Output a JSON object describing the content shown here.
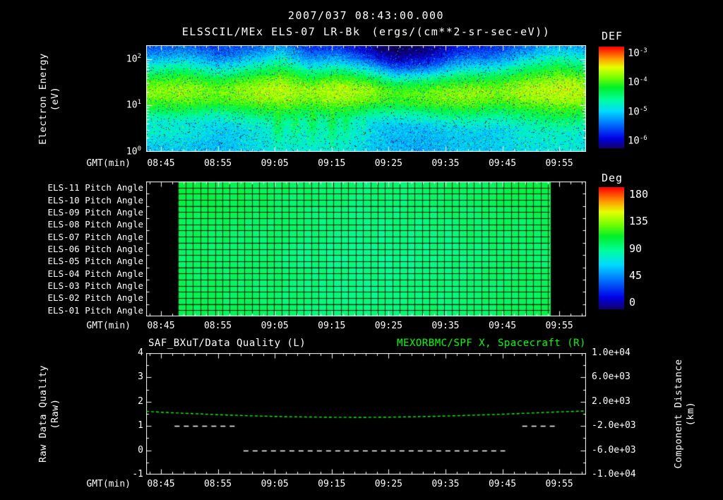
{
  "app": {
    "background": "#000000",
    "foreground": "#ffffff",
    "accent_green": "#00ff00"
  },
  "chart_data": [
    {
      "id": "electron_energy_spectrogram",
      "type": "heatmap",
      "timestamp": "2007/037 08:43:00.000",
      "title": "ELSSCIL/MEx ELS-07 LR-Bk",
      "units": "(ergs/(cm**2-sr-sec-eV))",
      "x": {
        "label": "GMT(min)",
        "tick_labels": [
          "08:45",
          "08:55",
          "09:05",
          "09:15",
          "09:25",
          "09:35",
          "09:45",
          "09:55"
        ],
        "tick_minutes": [
          0,
          10,
          20,
          30,
          40,
          50,
          60,
          70
        ],
        "start_min": -2.6,
        "end_min": 74.7,
        "minor_step_min": 2
      },
      "y": {
        "label_line1": "Electron Energy",
        "label_line2": "(eV)",
        "scale": "log",
        "range_ev": [
          1,
          200
        ],
        "tick_exponents": [
          "2",
          "1",
          "0"
        ]
      },
      "z": {
        "label": "DEF",
        "log10_range": [
          -6,
          -3
        ],
        "tick_exponents": [
          "-3",
          "-4",
          "-5",
          "-6"
        ]
      },
      "band_keyframes": [
        {
          "t": -2.6,
          "peak": -3.9,
          "center": 1.3,
          "width": 0.3,
          "low": -5.0,
          "high": -5.6,
          "down": 0.25,
          "l2": 0.8
        },
        {
          "t": 4,
          "peak": -3.85,
          "center": 1.32,
          "width": 0.32,
          "low": -5.0,
          "high": -5.6,
          "down": 0.3,
          "l2": 0.7
        },
        {
          "t": 10,
          "peak": -3.95,
          "center": 1.28,
          "width": 0.27,
          "low": -5.05,
          "high": -5.6,
          "down": 0.25,
          "l2": 0.3
        },
        {
          "t": 16,
          "peak": -3.8,
          "center": 1.3,
          "width": 0.3,
          "low": -4.95,
          "high": -5.55,
          "down": 0.4,
          "l2": 0
        },
        {
          "t": 21,
          "peak": -3.72,
          "center": 1.33,
          "width": 0.34,
          "low": -4.85,
          "high": -5.5,
          "down": 0.6,
          "l2": 0
        },
        {
          "t": 26,
          "peak": -3.85,
          "center": 1.28,
          "width": 0.3,
          "low": -4.9,
          "high": -5.75,
          "down": 0.7,
          "l2": 0
        },
        {
          "t": 31,
          "peak": -3.72,
          "center": 1.3,
          "width": 0.31,
          "low": -4.85,
          "high": -5.8,
          "down": 0.8,
          "l2": 0
        },
        {
          "t": 36,
          "peak": -3.82,
          "center": 1.3,
          "width": 0.28,
          "low": -5.0,
          "high": -6.0,
          "down": 0.5,
          "l2": 0
        },
        {
          "t": 41,
          "peak": -4.05,
          "center": 1.24,
          "width": 0.26,
          "low": -5.1,
          "high": -6.2,
          "down": 0.3,
          "l2": 0
        },
        {
          "t": 47,
          "peak": -3.95,
          "center": 1.22,
          "width": 0.27,
          "low": -5.1,
          "high": -6.05,
          "down": 0.25,
          "l2": 0
        },
        {
          "t": 53,
          "peak": -3.85,
          "center": 1.25,
          "width": 0.3,
          "low": -5.0,
          "high": -5.8,
          "down": 0.3,
          "l2": 0
        },
        {
          "t": 59,
          "peak": -3.9,
          "center": 1.28,
          "width": 0.29,
          "low": -5.0,
          "high": -5.7,
          "down": 0.35,
          "l2": 0
        },
        {
          "t": 64,
          "peak": -3.78,
          "center": 1.31,
          "width": 0.33,
          "low": -4.9,
          "high": -5.6,
          "down": 0.45,
          "l2": 0
        },
        {
          "t": 70,
          "peak": -3.7,
          "center": 1.33,
          "width": 0.37,
          "low": -4.85,
          "high": -5.5,
          "down": 0.5,
          "l2": 0
        },
        {
          "t": 74.7,
          "peak": -3.75,
          "center": 1.31,
          "width": 0.35,
          "low": -4.9,
          "high": -5.55,
          "down": 0.45,
          "l2": 0
        }
      ],
      "streaks": [
        {
          "t": 20.5,
          "w": 0.9,
          "amp": 0.95
        },
        {
          "t": 23.5,
          "w": 0.8,
          "amp": 0.85
        },
        {
          "t": 26.5,
          "w": 0.9,
          "amp": 1.0
        },
        {
          "t": 30,
          "w": 0.8,
          "amp": 0.95
        },
        {
          "t": 32.5,
          "w": 0.7,
          "amp": 0.8
        },
        {
          "t": 35.5,
          "w": 0.6,
          "amp": 0.65
        }
      ]
    },
    {
      "id": "pitch_angle_panels",
      "type": "heatmap",
      "rows": [
        "ELS-11 Pitch Angle",
        "ELS-10 Pitch Angle",
        "ELS-09 Pitch Angle",
        "ELS-08 Pitch Angle",
        "ELS-07 Pitch Angle",
        "ELS-06 Pitch Angle",
        "ELS-05 Pitch Angle",
        "ELS-04 Pitch Angle",
        "ELS-03 Pitch Angle",
        "ELS-02 Pitch Angle",
        "ELS-01 Pitch Angle"
      ],
      "z": {
        "label": "Deg",
        "range": [
          0,
          180
        ],
        "ticks": [
          "180",
          "135",
          "90",
          "45",
          "0"
        ],
        "tick_values": [
          180,
          135,
          90,
          45,
          0
        ]
      },
      "data_start_min": 3.0,
      "data_end_min": 68.3,
      "base_deg": 101,
      "row_offsets_deg": [
        3,
        2,
        1,
        0,
        -1,
        -2,
        -2,
        -1,
        -1,
        0,
        1
      ],
      "mid_dip": {
        "center_min": 38,
        "sigma_min": 16,
        "depth_deg": 9
      },
      "cell_min": 1.3,
      "subrows_per_panel": 2
    },
    {
      "id": "quality_and_distance",
      "type": "line",
      "title_left": "SAF_BXuT/Data Quality (L)",
      "title_right": "MEXORBMC/SPF X, Spacecraft (R)",
      "x_label": "GMT(min)",
      "y_left": {
        "label_line1": "Raw Data Quality",
        "label_line2": "(Raw)",
        "range": [
          -1,
          4
        ],
        "ticks": [
          "4",
          "3",
          "2",
          "1",
          "0",
          "-1"
        ],
        "tick_values": [
          4,
          3,
          2,
          1,
          0,
          -1
        ]
      },
      "y_right": {
        "label_line1": "Component Distance",
        "label_line2": "(km)",
        "range": [
          -10000,
          10000
        ],
        "ticks": [
          "1.0e+04",
          "6.0e+03",
          "2.0e+03",
          "-2.0e+03",
          "-6.0e+03",
          "-1.0e+04"
        ],
        "tick_values": [
          10000,
          6000,
          2000,
          -2000,
          -6000,
          -10000
        ]
      },
      "series": [
        {
          "name": "spacecraft-x-distance",
          "axis": "right",
          "color": "#00ff00",
          "style": "dashed",
          "points_min_km": [
            [
              -2.6,
              420
            ],
            [
              0,
              260
            ],
            [
              5,
              60
            ],
            [
              10,
              -140
            ],
            [
              15,
              -300
            ],
            [
              20,
              -430
            ],
            [
              25,
              -510
            ],
            [
              30,
              -560
            ],
            [
              35,
              -580
            ],
            [
              40,
              -550
            ],
            [
              45,
              -470
            ],
            [
              50,
              -360
            ],
            [
              55,
              -220
            ],
            [
              60,
              -60
            ],
            [
              65,
              130
            ],
            [
              70,
              320
            ],
            [
              74.7,
              470
            ]
          ]
        },
        {
          "name": "raw-data-quality",
          "axis": "left",
          "color": "#ffffff",
          "style": "dashed",
          "segments": [
            {
              "value": 1,
              "from_min": 2.4,
              "to_min": 13.5
            },
            {
              "value": 0,
              "from_min": 14.5,
              "to_min": 60.5
            },
            {
              "value": 1,
              "from_min": 63.5,
              "to_min": 69.5
            }
          ]
        }
      ]
    }
  ]
}
